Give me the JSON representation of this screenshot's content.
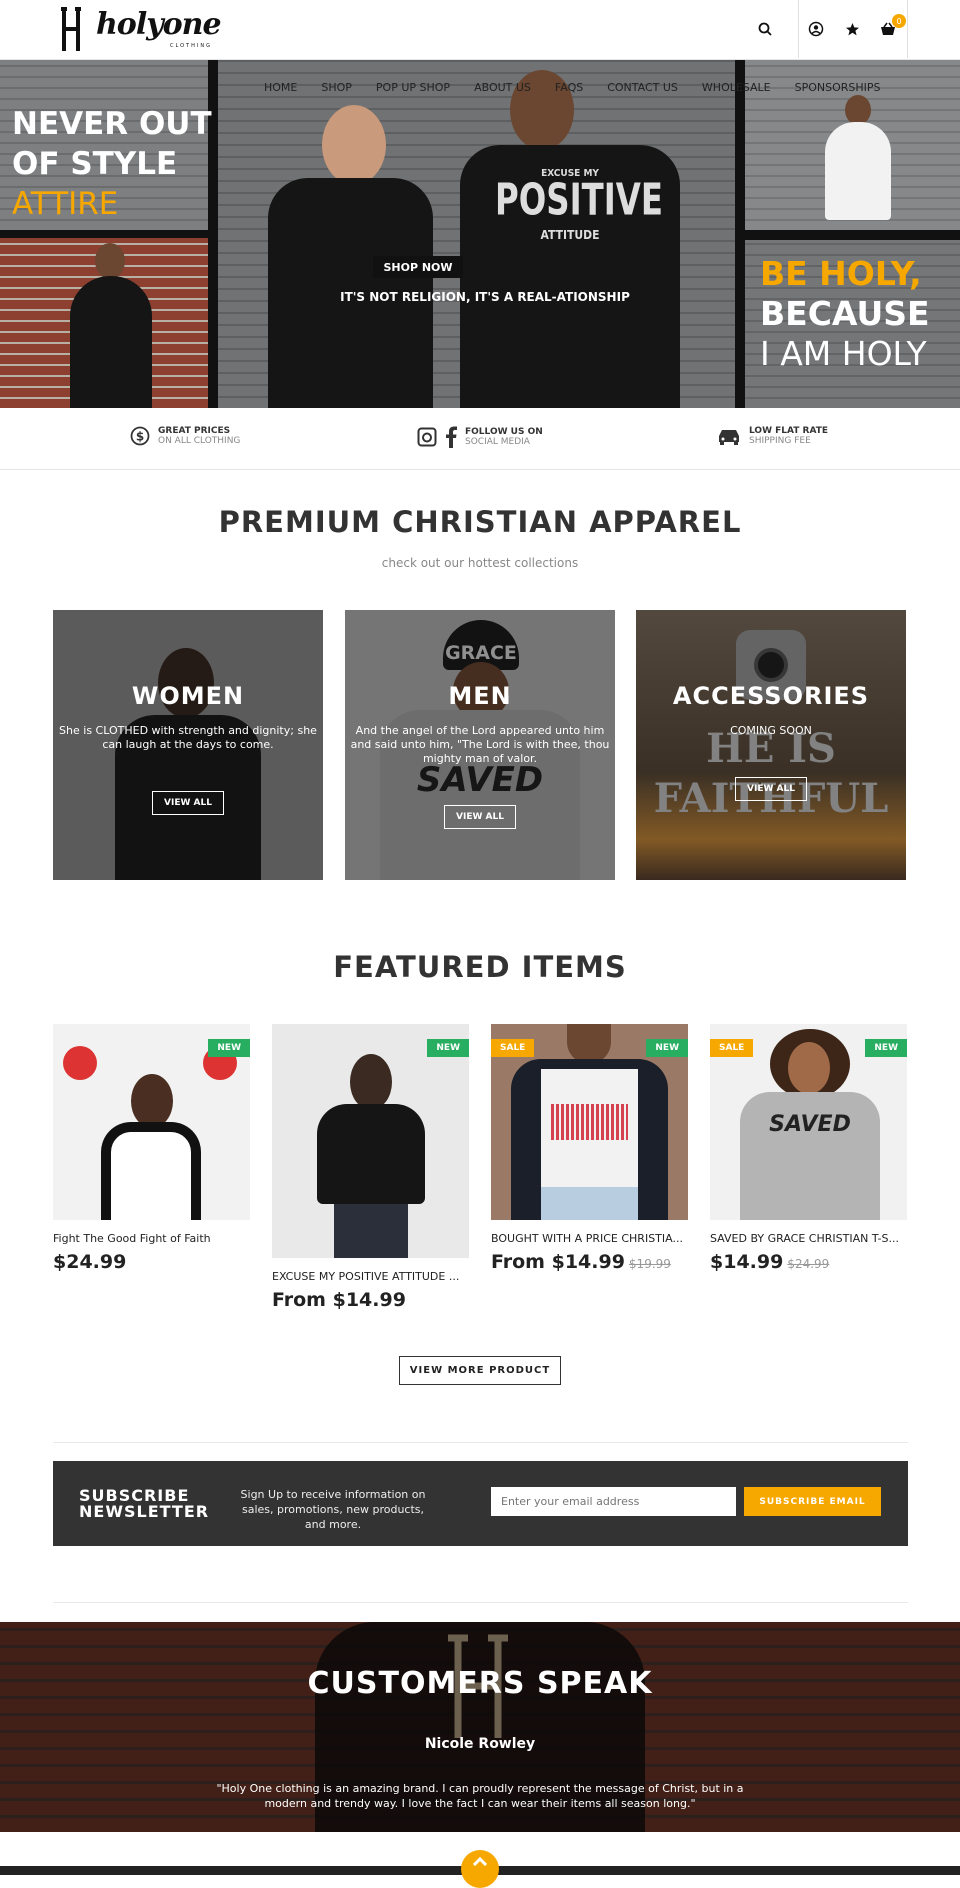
{
  "header": {
    "logo_text": "holyone",
    "logo_sub": "CLOTHING",
    "cart_count": "0"
  },
  "nav": [
    "HOME",
    "SHOP",
    "POP UP SHOP",
    "ABOUT US",
    "FAQS",
    "CONTACT US",
    "WHOLESALE",
    "SPONSORSHIPS"
  ],
  "hero": {
    "left_line1": "NEVER OUT",
    "left_line2": "OF STYLE",
    "left_line3": "ATTIRE",
    "right_line1": "BE HOLY,",
    "right_line2": "BECAUSE",
    "right_line3": "I AM HOLY",
    "shirt_line1": "EXCUSE MY",
    "shirt_line2": "POSITIVE",
    "shirt_line3": "ATTITUDE",
    "cta": "SHOP NOW",
    "tagline": "IT'S NOT RELIGION, IT'S A REAL-ATIONSHIP"
  },
  "features": [
    {
      "title": "GREAT PRICES",
      "sub": "ON ALL CLOTHING",
      "icon": "dollar-icon"
    },
    {
      "title": "FOLLOW US ON",
      "sub": "SOCIAL MEDIA",
      "icon": "social-icon"
    },
    {
      "title": "LOW FLAT RATE",
      "sub": "SHIPPING FEE",
      "icon": "car-icon"
    }
  ],
  "collections_section": {
    "title": "PREMIUM CHRISTIAN APPAREL",
    "subtitle": "check out our hottest collections",
    "items": [
      {
        "title": "WOMEN",
        "desc": "She is CLOTHED with strength and dignity; she can laugh at the days to come.",
        "btn": "VIEW ALL"
      },
      {
        "title": "MEN",
        "desc": "And the angel of the Lord appeared unto him and said unto him, \"The Lord is with thee, thou mighty man of valor.",
        "btn": "VIEW ALL"
      },
      {
        "title": "ACCESSORIES",
        "desc": "COMING SOON",
        "btn": "VIEW ALL"
      }
    ],
    "men_hat_text": "GRACE",
    "men_shirt_text": "SAVED",
    "acc_text1": "HE IS",
    "acc_text2": "FAITHFUL"
  },
  "featured": {
    "title": "FEATURED ITEMS",
    "products": [
      {
        "name": "Fight The Good Fight of Faith",
        "price": "$24.99",
        "old": "",
        "badge_new": "NEW",
        "badge_sale": ""
      },
      {
        "name": "EXCUSE MY POSITIVE ATTITUDE ...",
        "price": "From $14.99",
        "old": "",
        "badge_new": "NEW",
        "badge_sale": ""
      },
      {
        "name": "BOUGHT WITH A PRICE CHRISTIA...",
        "price": "From $14.99",
        "old": "$19.99",
        "badge_new": "NEW",
        "badge_sale": "SALE"
      },
      {
        "name": "SAVED BY GRACE CHRISTIAN T-S...",
        "price": "$14.99",
        "old": "$24.99",
        "badge_new": "NEW",
        "badge_sale": "SALE"
      }
    ],
    "more_btn": "VIEW MORE PRODUCT"
  },
  "newsletter": {
    "title_line1": "SUBSCRIBE",
    "title_line2": "NEWSLETTER",
    "desc": "Sign Up to receive information on sales, promotions, new products, and more.",
    "placeholder": "Enter your email address",
    "btn": "SUBSCRIBE EMAIL"
  },
  "testimonials": {
    "title": "CUSTOMERS SPEAK",
    "name": "Nicole Rowley",
    "quote": "\"Holy One clothing is an amazing brand. I can proudly represent the message of Christ, but in a modern and trendy way. I love the fact I can wear their items all season long.\""
  },
  "colors": {
    "accent": "#f7a800",
    "new_badge": "#27ae60",
    "dark": "#333333"
  }
}
